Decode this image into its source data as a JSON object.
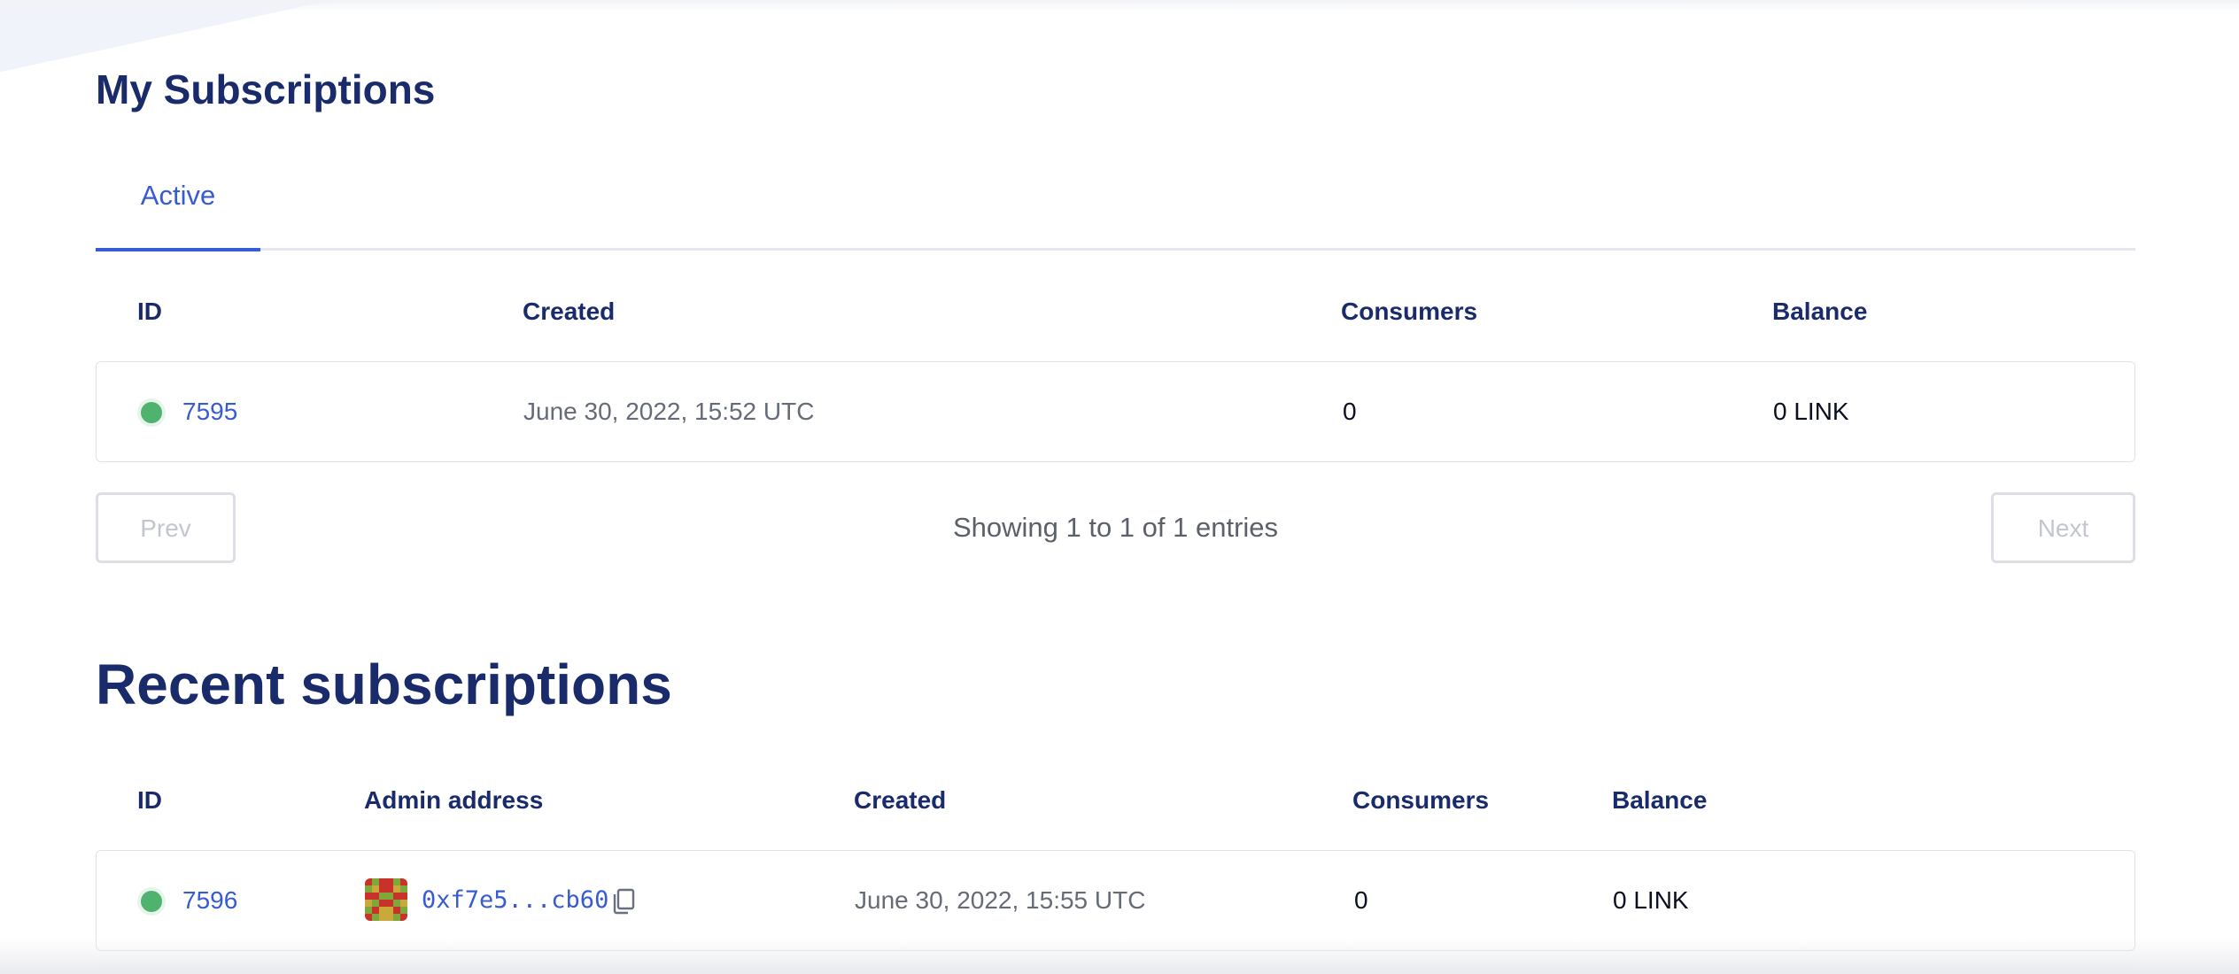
{
  "my_subscriptions": {
    "title": "My Subscriptions",
    "tabs": [
      {
        "label": "Active"
      }
    ],
    "columns": {
      "id": "ID",
      "created": "Created",
      "consumers": "Consumers",
      "balance": "Balance"
    },
    "rows": [
      {
        "id": "7595",
        "created": "June 30, 2022, 15:52 UTC",
        "consumers": "0",
        "balance": "0 LINK",
        "status_color": "#4fb26f"
      }
    ],
    "pagination": {
      "prev_label": "Prev",
      "next_label": "Next",
      "showing": "Showing 1 to 1 of 1 entries"
    }
  },
  "recent_subscriptions": {
    "title": "Recent subscriptions",
    "columns": {
      "id": "ID",
      "admin": "Admin address",
      "created": "Created",
      "consumers": "Consumers",
      "balance": "Balance"
    },
    "rows": [
      {
        "id": "7596",
        "admin_address": "0xf7e5...cb60",
        "created": "June 30, 2022, 15:55 UTC",
        "consumers": "0",
        "balance": "0 LINK",
        "status_color": "#4fb26f"
      }
    ]
  },
  "colors": {
    "accent": "#375bd2",
    "heading": "#1a2b6b",
    "status_active": "#4fb26f"
  },
  "icons": {
    "copy": "copy-icon",
    "avatar": "identicon"
  }
}
